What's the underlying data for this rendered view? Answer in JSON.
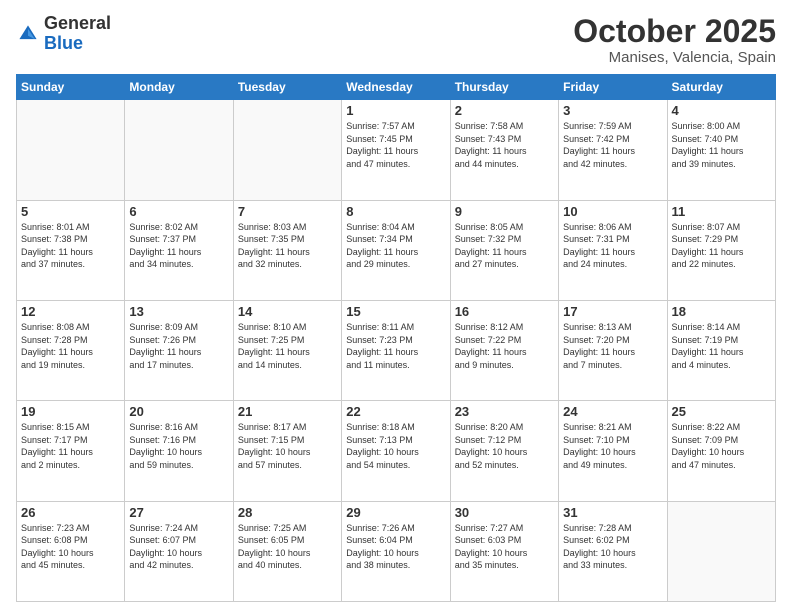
{
  "header": {
    "logo_general": "General",
    "logo_blue": "Blue",
    "title": "October 2025",
    "subtitle": "Manises, Valencia, Spain"
  },
  "weekdays": [
    "Sunday",
    "Monday",
    "Tuesday",
    "Wednesday",
    "Thursday",
    "Friday",
    "Saturday"
  ],
  "weeks": [
    [
      {
        "day": "",
        "info": ""
      },
      {
        "day": "",
        "info": ""
      },
      {
        "day": "",
        "info": ""
      },
      {
        "day": "1",
        "info": "Sunrise: 7:57 AM\nSunset: 7:45 PM\nDaylight: 11 hours\nand 47 minutes."
      },
      {
        "day": "2",
        "info": "Sunrise: 7:58 AM\nSunset: 7:43 PM\nDaylight: 11 hours\nand 44 minutes."
      },
      {
        "day": "3",
        "info": "Sunrise: 7:59 AM\nSunset: 7:42 PM\nDaylight: 11 hours\nand 42 minutes."
      },
      {
        "day": "4",
        "info": "Sunrise: 8:00 AM\nSunset: 7:40 PM\nDaylight: 11 hours\nand 39 minutes."
      }
    ],
    [
      {
        "day": "5",
        "info": "Sunrise: 8:01 AM\nSunset: 7:38 PM\nDaylight: 11 hours\nand 37 minutes."
      },
      {
        "day": "6",
        "info": "Sunrise: 8:02 AM\nSunset: 7:37 PM\nDaylight: 11 hours\nand 34 minutes."
      },
      {
        "day": "7",
        "info": "Sunrise: 8:03 AM\nSunset: 7:35 PM\nDaylight: 11 hours\nand 32 minutes."
      },
      {
        "day": "8",
        "info": "Sunrise: 8:04 AM\nSunset: 7:34 PM\nDaylight: 11 hours\nand 29 minutes."
      },
      {
        "day": "9",
        "info": "Sunrise: 8:05 AM\nSunset: 7:32 PM\nDaylight: 11 hours\nand 27 minutes."
      },
      {
        "day": "10",
        "info": "Sunrise: 8:06 AM\nSunset: 7:31 PM\nDaylight: 11 hours\nand 24 minutes."
      },
      {
        "day": "11",
        "info": "Sunrise: 8:07 AM\nSunset: 7:29 PM\nDaylight: 11 hours\nand 22 minutes."
      }
    ],
    [
      {
        "day": "12",
        "info": "Sunrise: 8:08 AM\nSunset: 7:28 PM\nDaylight: 11 hours\nand 19 minutes."
      },
      {
        "day": "13",
        "info": "Sunrise: 8:09 AM\nSunset: 7:26 PM\nDaylight: 11 hours\nand 17 minutes."
      },
      {
        "day": "14",
        "info": "Sunrise: 8:10 AM\nSunset: 7:25 PM\nDaylight: 11 hours\nand 14 minutes."
      },
      {
        "day": "15",
        "info": "Sunrise: 8:11 AM\nSunset: 7:23 PM\nDaylight: 11 hours\nand 11 minutes."
      },
      {
        "day": "16",
        "info": "Sunrise: 8:12 AM\nSunset: 7:22 PM\nDaylight: 11 hours\nand 9 minutes."
      },
      {
        "day": "17",
        "info": "Sunrise: 8:13 AM\nSunset: 7:20 PM\nDaylight: 11 hours\nand 7 minutes."
      },
      {
        "day": "18",
        "info": "Sunrise: 8:14 AM\nSunset: 7:19 PM\nDaylight: 11 hours\nand 4 minutes."
      }
    ],
    [
      {
        "day": "19",
        "info": "Sunrise: 8:15 AM\nSunset: 7:17 PM\nDaylight: 11 hours\nand 2 minutes."
      },
      {
        "day": "20",
        "info": "Sunrise: 8:16 AM\nSunset: 7:16 PM\nDaylight: 10 hours\nand 59 minutes."
      },
      {
        "day": "21",
        "info": "Sunrise: 8:17 AM\nSunset: 7:15 PM\nDaylight: 10 hours\nand 57 minutes."
      },
      {
        "day": "22",
        "info": "Sunrise: 8:18 AM\nSunset: 7:13 PM\nDaylight: 10 hours\nand 54 minutes."
      },
      {
        "day": "23",
        "info": "Sunrise: 8:20 AM\nSunset: 7:12 PM\nDaylight: 10 hours\nand 52 minutes."
      },
      {
        "day": "24",
        "info": "Sunrise: 8:21 AM\nSunset: 7:10 PM\nDaylight: 10 hours\nand 49 minutes."
      },
      {
        "day": "25",
        "info": "Sunrise: 8:22 AM\nSunset: 7:09 PM\nDaylight: 10 hours\nand 47 minutes."
      }
    ],
    [
      {
        "day": "26",
        "info": "Sunrise: 7:23 AM\nSunset: 6:08 PM\nDaylight: 10 hours\nand 45 minutes."
      },
      {
        "day": "27",
        "info": "Sunrise: 7:24 AM\nSunset: 6:07 PM\nDaylight: 10 hours\nand 42 minutes."
      },
      {
        "day": "28",
        "info": "Sunrise: 7:25 AM\nSunset: 6:05 PM\nDaylight: 10 hours\nand 40 minutes."
      },
      {
        "day": "29",
        "info": "Sunrise: 7:26 AM\nSunset: 6:04 PM\nDaylight: 10 hours\nand 38 minutes."
      },
      {
        "day": "30",
        "info": "Sunrise: 7:27 AM\nSunset: 6:03 PM\nDaylight: 10 hours\nand 35 minutes."
      },
      {
        "day": "31",
        "info": "Sunrise: 7:28 AM\nSunset: 6:02 PM\nDaylight: 10 hours\nand 33 minutes."
      },
      {
        "day": "",
        "info": ""
      }
    ]
  ]
}
